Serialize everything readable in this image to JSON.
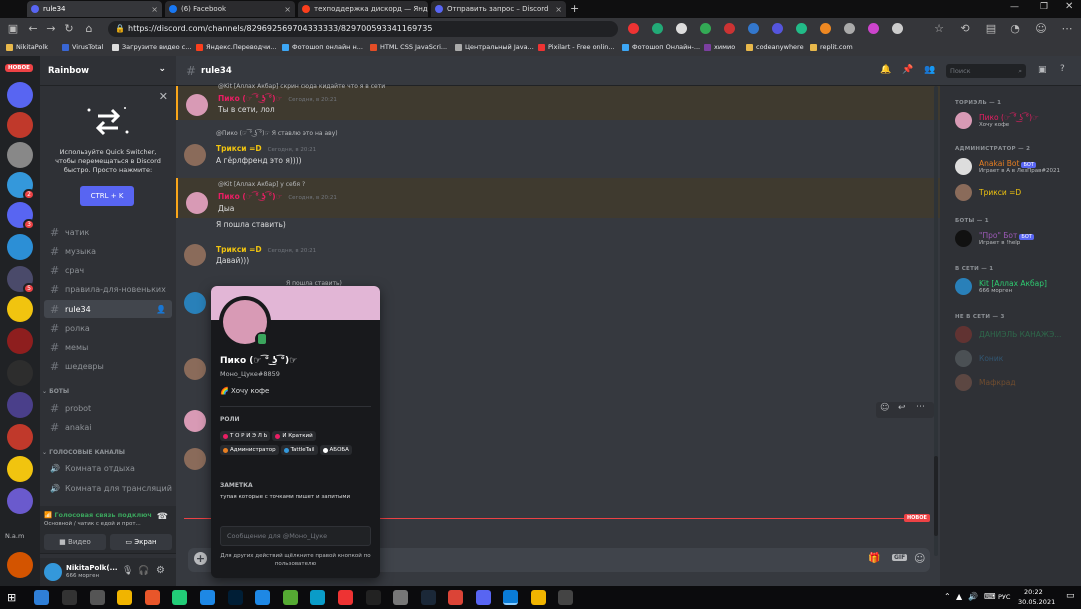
{
  "browser": {
    "tabs": [
      {
        "title": "rule34"
      },
      {
        "title": "(6) Facebook"
      },
      {
        "title": "техподдержка дискорд — Янде"
      },
      {
        "title": "Отправить запрос – Discord"
      }
    ],
    "url": "https://discord.com/channels/829692569704333333/829700593341169735",
    "bookmarks": [
      "NikitaPolk",
      "VirusTotal",
      "Загрузите видео с...",
      "Яндекс.Переводчи...",
      "Фотошоп онлайн н...",
      "HTML CSS JavaScri...",
      "Центральный Java...",
      "Pixilart - Free onlin...",
      "Фотошоп Онлайн-...",
      "химио",
      "codeanywhere",
      "replit.com"
    ]
  },
  "guilds": {
    "new_badge": "НОВОЕ",
    "badges": [
      "2",
      "3",
      "5"
    ],
    "bottom_label": "N.a.m"
  },
  "server": {
    "name": "Rainbow",
    "quick_switcher": {
      "text": "Используйте Quick Switcher, чтобы перемещаться в Discord быстро. Просто нажмите:",
      "button": "CTRL + K"
    },
    "channels": [
      "чатик",
      "музыка",
      "срач",
      "правила-для-новеньких",
      "rule34",
      "ролка",
      "мемы",
      "шедевры"
    ],
    "bots_category": "БОТЫ",
    "bot_channels": [
      "probot",
      "anakai"
    ],
    "voice_category": "ГОЛОСОВЫЕ КАНАЛЫ",
    "voice_channels": [
      "Комната отдыха",
      "Комната для трансляций"
    ]
  },
  "voice_panel": {
    "status": "Голосовая связь подключ",
    "sub": "Основной / чатик с едой и прот...",
    "video_label": "Видео",
    "screen_label": "Экран"
  },
  "user": {
    "name": "NikitaPolk(...",
    "status": "666 морген"
  },
  "chat": {
    "channel": "rule34",
    "search_placeholder": "Поиск",
    "messages": [
      {
        "reply": "@Kit [Аллах Акбар] скрин сюда кидайте что я в сети",
        "author": "Пико (☞ ͡° ͜ʖ ͡°)☞",
        "time": "Сегодня, в 20:21",
        "text": "Ты в сети, лол"
      },
      {
        "reply": "@Пико (☞ ͡° ͜ʖ ͡°)☞ Я ставлю это на аву)",
        "author": "Трикси =D",
        "time": "Сегодня, в 20:21",
        "text": "А гёрлфренд это я))))"
      },
      {
        "reply": "@Kit [Аллах Акбар] у себя ?",
        "author": "Пико (☞ ͡° ͜ʖ ͡°)☞",
        "time": "Сегодня, в 20:21",
        "text": "Дыа"
      },
      {
        "reply": "",
        "author": "",
        "time": "",
        "text": "Я пошла ставить)"
      },
      {
        "reply": "",
        "author": "Трикси =D",
        "time": "Сегодня, в 20:21",
        "text": "Давай)))"
      },
      {
        "reply": "Я пошла ставить)",
        "author": "",
        "time": "",
        "text": ""
      }
    ],
    "new_divider": "НОВОЕ",
    "input_placeholder": "Сообщение для @Моно_Цуке"
  },
  "profile": {
    "name": "Пико (☞ ͡° ͜ʖ ͡°)☞",
    "tag": "Моно_Цуке#8859",
    "custom_status": "Хочу кофе",
    "roles_title": "РОЛИ",
    "roles": [
      {
        "name": "Т О Р И Э Л Ь",
        "color": "#e91e63"
      },
      {
        "name": "И Краткий",
        "color": "#e91e63"
      },
      {
        "name": "Администратор",
        "color": "#e67e22"
      },
      {
        "name": "TattleTail",
        "color": "#3498db"
      },
      {
        "name": "АБОБА",
        "color": "#ffffff"
      }
    ],
    "note_title": "ЗАМЕТКА",
    "note": "тупая которые с точками пишет и запитыми",
    "message_placeholder": "Сообщение для @Моно_Цуке",
    "hint": "Для других действий щёлкните правой кнопкой по пользователю"
  },
  "members": {
    "groups": [
      {
        "title": "ТОРИЭЛЬ — 1",
        "members": [
          {
            "name": "Пико (☞ ͡° ͜ʖ ͡°)☞",
            "status": "Хочу кофе",
            "color": "#e91e63"
          }
        ]
      },
      {
        "title": "АДМИНИСТРАТОР — 2",
        "members": [
          {
            "name": "Anakai Bot",
            "status": "Играет в А в ЛезПрав#2021",
            "color": "#e67e22",
            "bot": "БОТ"
          },
          {
            "name": "Трикси =D",
            "status": "",
            "color": "#f1c40f"
          }
        ]
      },
      {
        "title": "БОТЫ — 1",
        "members": [
          {
            "name": "\"Про\" Бот",
            "status": "Играет в !help",
            "color": "#9b59b6",
            "bot": "БОТ"
          }
        ]
      },
      {
        "title": "В СЕТИ — 1",
        "members": [
          {
            "name": "Kit [Аллах Акбар]",
            "status": "666 морген",
            "color": "#2ecc71"
          }
        ]
      },
      {
        "title": "НЕ В СЕТИ — 3",
        "members": [
          {
            "name": "ДАНИЭЛЬ КАНАЖЭ...",
            "status": "",
            "color": "#2ecc71"
          },
          {
            "name": "Коник",
            "status": "",
            "color": "#3498db"
          },
          {
            "name": "Мафкрад",
            "status": "",
            "color": "#e67e22"
          }
        ]
      }
    ]
  },
  "taskbar": {
    "lang": "РУС",
    "time": "20:22",
    "date": "30.05.2021"
  }
}
